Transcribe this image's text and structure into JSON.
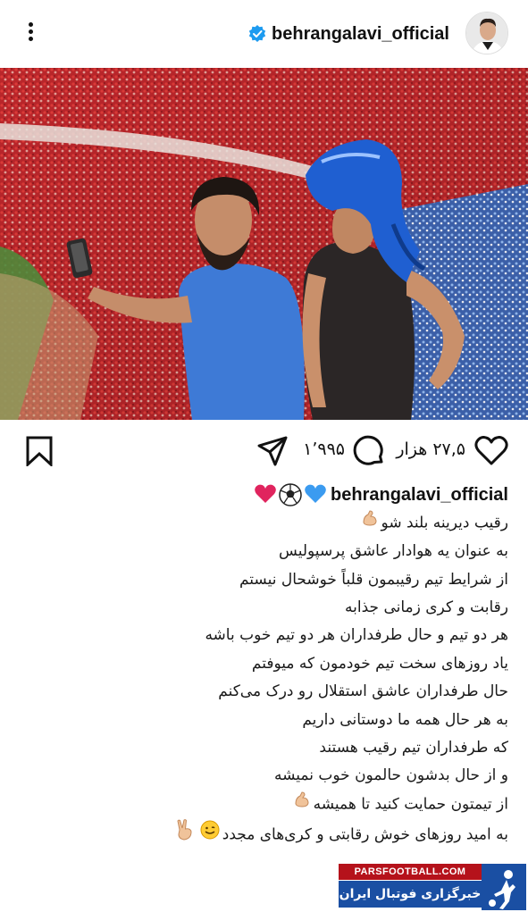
{
  "post": {
    "username": "behrangalavi_official",
    "likes": "۲۷,۵ هزار",
    "comments": "۱٬۹۹۵"
  },
  "caption": {
    "username": "behrangalavi_official",
    "lines": [
      "رقیب دیرینه بلند شو",
      "به عنوان یه هوادار عاشق پرسپولیس",
      "از شرایط تیم رقیبمون قلباً خوشحال نیستم",
      "رقابت و کری زمانی جذابه",
      "هر دو تیم و حال طرفداران هر دو تیم خوب باشه",
      "یاد روزهای سخت تیم خودمون که میوفتم",
      "حال طرفداران عاشق استقلال رو درک می‌کنم",
      "به هر حال همه ما دوستانی داریم",
      "که طرفداران تیم رقیب هستند",
      "و از حال بدشون حالمون خوب نمیشه",
      "از تیمتون حمایت کنید تا همیشه",
      "به امید روزهای خوش رقابتی و کری‌های مجدد"
    ]
  },
  "watermark": {
    "top": "PARSFOOTBALL.COM",
    "bottom": "خبرگزاری فوتبال ایران"
  },
  "colors": {
    "verified": "#1d9bf0",
    "red_heart": "#e0245e",
    "blue_heart": "#3b9bf0",
    "badge_red": "#b5121b",
    "badge_blue": "#1a4fa3"
  },
  "icons": [
    "more-icon",
    "verified-icon",
    "bookmark-icon",
    "heart-icon",
    "comment-icon",
    "share-icon",
    "flexed-biceps-icon",
    "smile-icon",
    "victory-hand-icon"
  ]
}
